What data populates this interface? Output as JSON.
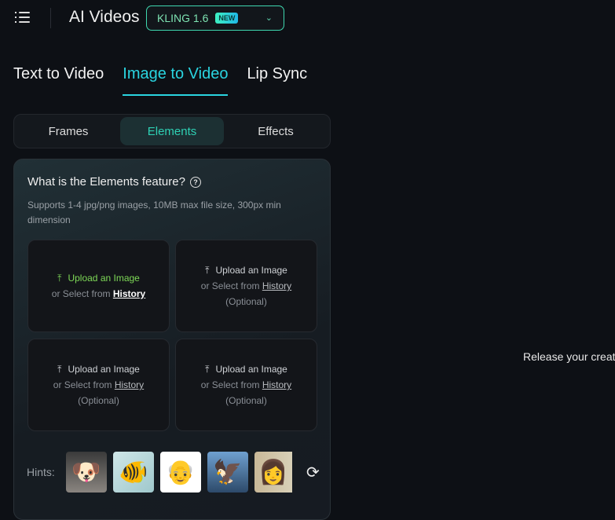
{
  "header": {
    "title": "AI Videos",
    "model": {
      "name": "KLING 1.6",
      "badge": "NEW"
    }
  },
  "tabs": [
    {
      "label": "Text to Video"
    },
    {
      "label": "Image to Video",
      "active": true
    },
    {
      "label": "Lip Sync"
    }
  ],
  "segments": [
    {
      "label": "Frames"
    },
    {
      "label": "Elements",
      "active": true
    },
    {
      "label": "Effects"
    }
  ],
  "panel": {
    "heading": "What is the Elements feature?",
    "description": "Supports 1-4 jpg/png images, 10MB max file size, 300px min dimension",
    "uploads": [
      {
        "upload": "Upload an Image",
        "select": "or Select from",
        "history": "History"
      },
      {
        "upload": "Upload an Image",
        "select": "or Select from",
        "history": "History",
        "optional": "(Optional)"
      },
      {
        "upload": "Upload an Image",
        "select": "or Select from",
        "history": "History",
        "optional": "(Optional)"
      },
      {
        "upload": "Upload an Image",
        "select": "or Select from",
        "history": "History",
        "optional": "(Optional)"
      }
    ],
    "hints_label": "Hints:"
  },
  "hints": [
    "puppy",
    "goldfish",
    "cartoon-grandpa",
    "pegasus",
    "woman"
  ],
  "canvas": {
    "text": "Release your creat"
  }
}
